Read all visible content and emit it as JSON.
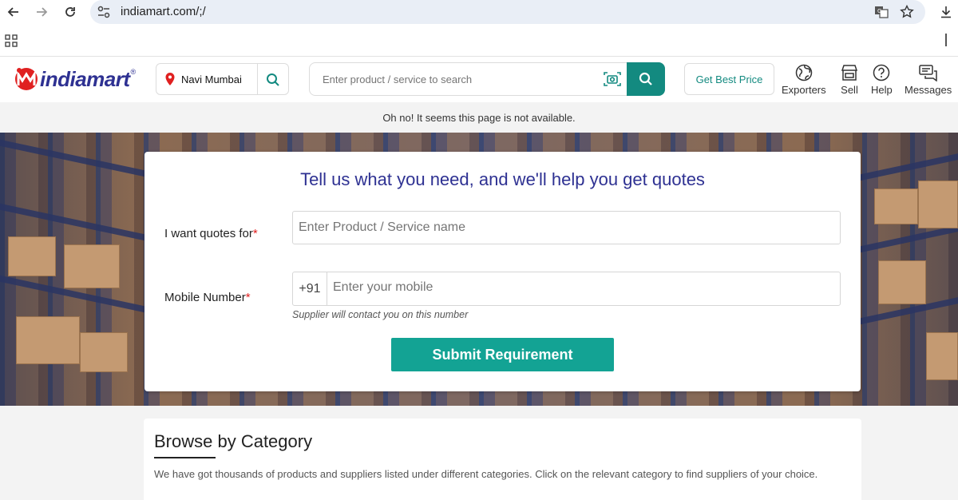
{
  "browser": {
    "url": "indiamart.com/;/"
  },
  "header": {
    "logo_text": "indiamart",
    "location": "Navi Mumbai",
    "search_placeholder": "Enter product / service to search",
    "best_price_label": "Get Best Price",
    "links": [
      {
        "label": "Exporters",
        "icon": "globe-icon"
      },
      {
        "label": "Sell",
        "icon": "store-icon"
      },
      {
        "label": "Help",
        "icon": "help-icon"
      },
      {
        "label": "Messages",
        "icon": "messages-icon"
      }
    ]
  },
  "notice": "Oh no! It seems this page is not available.",
  "quote_form": {
    "title": "Tell us what you need, and we'll help you get quotes",
    "product_label": "I want quotes for",
    "product_placeholder": "Enter Product / Service name",
    "mobile_label": "Mobile Number",
    "required_mark": "*",
    "country_code": "+91",
    "mobile_placeholder": "Enter your mobile",
    "helper_text": "Supplier will contact you on this number",
    "submit_label": "Submit Requirement"
  },
  "browse": {
    "title": "Browse by Category",
    "description": "We have got thousands of products and suppliers listed under different categories. Click on the relevant category to find suppliers of your choice."
  },
  "colors": {
    "brand_blue": "#2e3192",
    "teal": "#138a80",
    "submit_teal": "#13a394",
    "logo_red": "#e02020"
  }
}
